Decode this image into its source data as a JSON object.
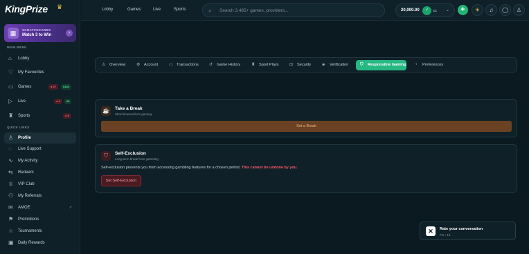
{
  "brand": {
    "logo": "KingPrize"
  },
  "promo": {
    "subtitle": "SCRATCHCARDS",
    "title": "Match 3 to Win"
  },
  "sidebar": {
    "main_menu_label": "MAIN MENU",
    "main_items": [
      {
        "label": "Lobby",
        "icon": "home-icon"
      },
      {
        "label": "My Favourites",
        "icon": "heart-icon"
      },
      {
        "label": "Games",
        "icon": "gamepad-icon",
        "badges": [
          "● 27",
          "6440"
        ]
      },
      {
        "label": "Live",
        "icon": "video-icon",
        "badges": [
          "● 2",
          "96"
        ]
      },
      {
        "label": "Sports",
        "icon": "trophy-icon",
        "badges": [
          "● 5"
        ]
      }
    ],
    "quick_links_label": "QUICK LINKS",
    "quick_items": [
      {
        "label": "Profile",
        "icon": "user-icon",
        "active": true
      },
      {
        "label": "Live Support",
        "icon": "support-icon"
      },
      {
        "label": "My Activity",
        "icon": "activity-icon"
      },
      {
        "label": "Redeem",
        "icon": "redeem-icon"
      },
      {
        "label": "VIP Club",
        "icon": "crown-icon"
      },
      {
        "label": "My Referrals",
        "icon": "users-icon"
      },
      {
        "label": "AMOE",
        "icon": "mail-icon"
      },
      {
        "label": "Promotions",
        "icon": "gift-icon"
      },
      {
        "label": "Tournaments",
        "icon": "trophy-icon"
      },
      {
        "label": "Daily Rewards",
        "icon": "calendar-icon"
      }
    ]
  },
  "topbar": {
    "nav": [
      "Lobby",
      "Games",
      "Live",
      "Sports"
    ],
    "search_placeholder": "Search 3,485+ games, providers...",
    "balance": "20,000.00",
    "currency": "SC"
  },
  "tabs": [
    {
      "label": "Overview",
      "icon": "user-icon"
    },
    {
      "label": "Account",
      "icon": "gear-icon"
    },
    {
      "label": "Transactions",
      "icon": "card-icon"
    },
    {
      "label": "Game History",
      "icon": "history-icon"
    },
    {
      "label": "Sport Plays",
      "icon": "trophy-icon"
    },
    {
      "label": "Security",
      "icon": "lock-icon"
    },
    {
      "label": "Verification",
      "icon": "shield-check-icon"
    },
    {
      "label": "Responsible Gaming",
      "icon": "shield-icon",
      "active": true
    },
    {
      "label": "Preferences",
      "icon": "bell-icon"
    }
  ],
  "take_break": {
    "title": "Take a Break",
    "subtitle": "Short timeout from gaming",
    "button": "Set a Break"
  },
  "self_exclusion": {
    "title": "Self-Exclusion",
    "subtitle": "Long-term break from gambling",
    "description": "Self-exclusion prevents you from accessing gambling features for a chosen period.",
    "warning": "This cannot be undone by you.",
    "button": "Set Self-Exclusion"
  },
  "toast": {
    "title": "Rate your conversation",
    "meta": "Fin • 1d"
  },
  "colors": {
    "accent": "#26b883",
    "warning": "#ff5a6a",
    "break_button": "#6a4223"
  }
}
